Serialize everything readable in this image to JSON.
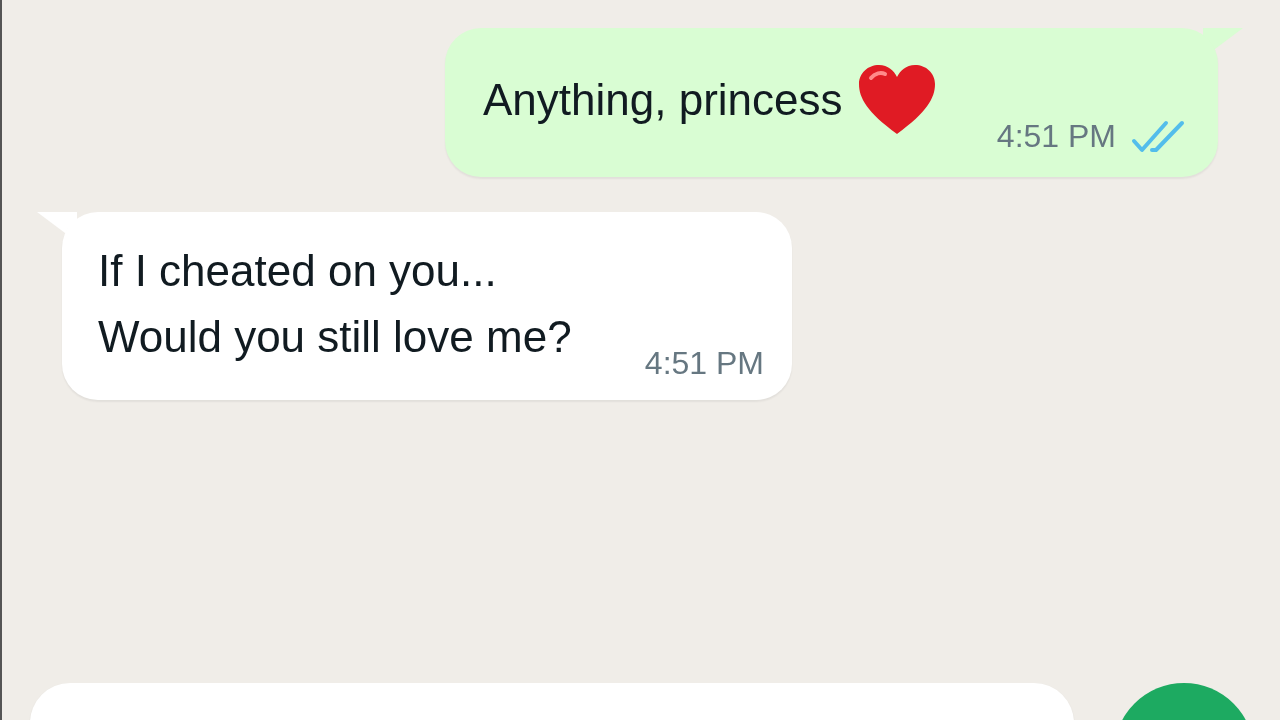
{
  "messages": [
    {
      "kind": "outgoing",
      "lines": [
        {
          "text": "Anything, princess",
          "trailing": {
            "kind": "heart"
          }
        }
      ],
      "time": "4:51 PM",
      "read": true
    },
    {
      "kind": "incoming",
      "lines": [
        {
          "text": "If I cheated on you..."
        },
        {
          "text": "Would you still love me?"
        }
      ],
      "time": "4:51 PM"
    }
  ]
}
